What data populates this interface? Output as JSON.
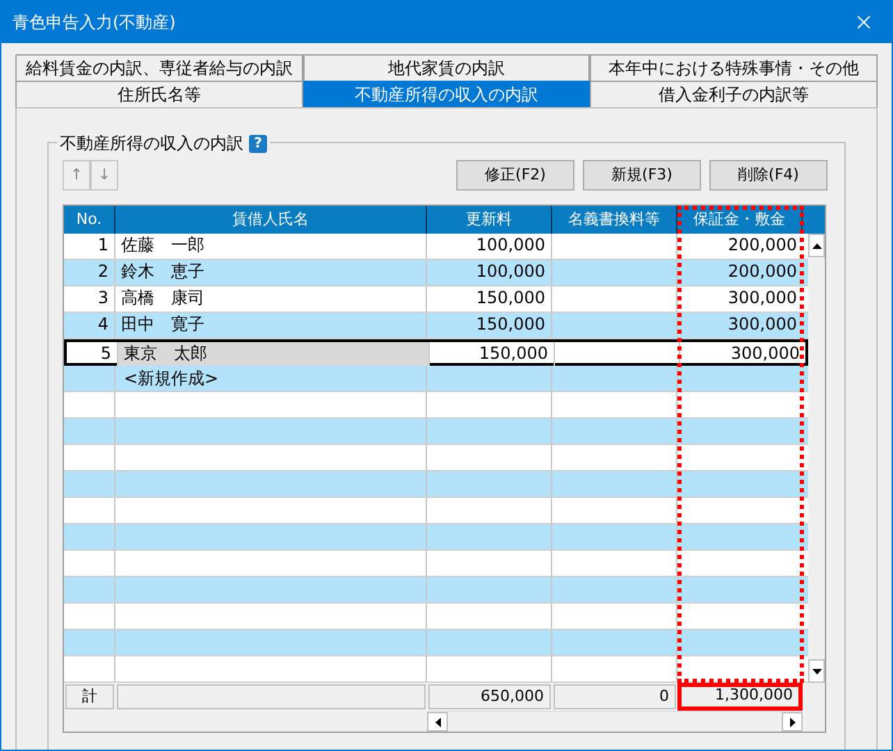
{
  "window": {
    "title": "青色申告入力(不動産)"
  },
  "tab_rows": [
    [
      {
        "label": "給料賃金の内訳、専従者給与の内訳",
        "selected": false
      },
      {
        "label": "地代家賃の内訳",
        "selected": false
      },
      {
        "label": "本年中における特殊事情・その他",
        "selected": false
      }
    ],
    [
      {
        "label": "住所氏名等",
        "selected": false
      },
      {
        "label": "不動産所得の収入の内訳",
        "selected": true
      },
      {
        "label": "借入金利子の内訳等",
        "selected": false
      }
    ]
  ],
  "group": {
    "title": "不動産所得の収入の内訳",
    "help": "?"
  },
  "move_buttons": [
    "↑",
    "↓"
  ],
  "buttons": [
    "修正(F2)",
    "新規(F3)",
    "削除(F4)"
  ],
  "table": {
    "columns": [
      "No.",
      "賃借人氏名",
      "更新料",
      "名義書換料等",
      "保証金・敷金"
    ],
    "rows": [
      {
        "no": "1",
        "name": "佐藤　一郎",
        "renewal": "100,000",
        "deposit": "200,000",
        "selected": false
      },
      {
        "no": "2",
        "name": "鈴木　恵子",
        "renewal": "100,000",
        "deposit": "200,000",
        "selected": false
      },
      {
        "no": "3",
        "name": "高橋　康司",
        "renewal": "150,000",
        "deposit": "300,000",
        "selected": false
      },
      {
        "no": "4",
        "name": "田中　寛子",
        "renewal": "150,000",
        "deposit": "300,000",
        "selected": false
      },
      {
        "no": "5",
        "name": "東京　太郎",
        "renewal": "150,000",
        "deposit": "300,000",
        "selected": true
      }
    ],
    "new_row": "<新規作成>",
    "totals": {
      "label": "計",
      "renewal": "650,000",
      "transfer": "0",
      "deposit": "1,300,000"
    }
  }
}
